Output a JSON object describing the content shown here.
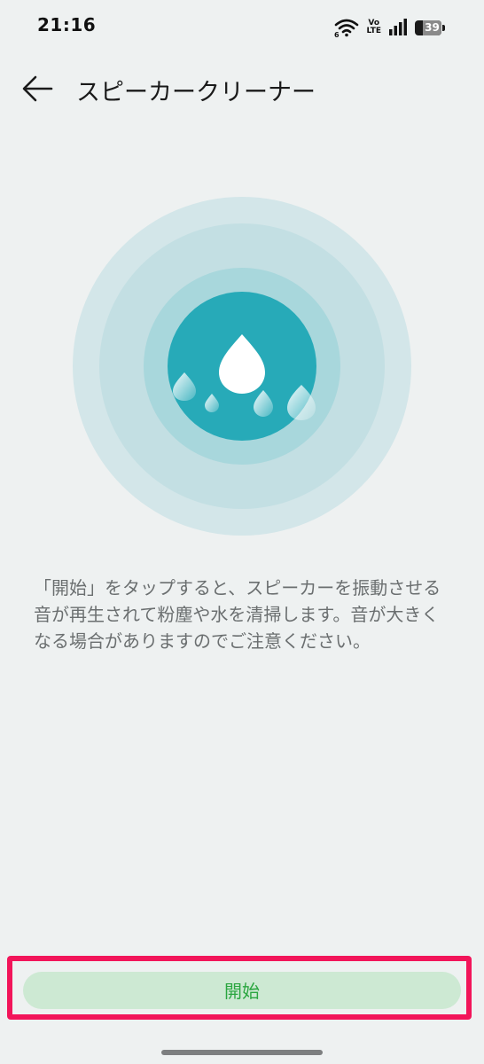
{
  "status_bar": {
    "time": "21:16",
    "wifi_icon": "wifi-6-icon",
    "volte_top": "Vo",
    "volte_bottom": "LTE",
    "signal_icon": "cell-signal-icon",
    "battery": "39"
  },
  "header": {
    "back_icon": "arrow-left-icon",
    "title": "スピーカークリーナー"
  },
  "illustration": {
    "icon": "water-drop-icon"
  },
  "description": "「開始」をタップすると、スピーカーを振動させる音が再生されて粉塵や水を清掃します。音が大きくなる場合がありますのでご注意ください。",
  "actions": {
    "start_label": "開始"
  },
  "colors": {
    "background": "#eef1f1",
    "teal_core": "#27aab8",
    "highlight": "#f2155a",
    "button_bg": "#cde9d3",
    "button_text": "#2ba640"
  }
}
